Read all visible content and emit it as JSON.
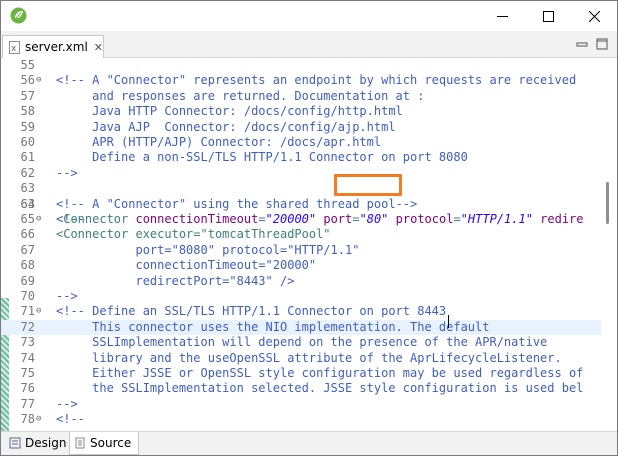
{
  "window": {
    "app_icon": "spring-leaf-icon",
    "controls": [
      "minimize-icon",
      "maximize-icon",
      "close-icon"
    ]
  },
  "tab": {
    "label": "server.xml",
    "close": "✕",
    "icon": "xml-file-icon"
  },
  "view_controls": [
    "minimize-view-icon",
    "maximize-view-icon"
  ],
  "editor": {
    "lines": [
      {
        "n": "55",
        "fold": "",
        "code": ""
      },
      {
        "n": "56",
        "fold": "⊖",
        "code": "<!-- A \"Connector\" represents an endpoint by which requests are received"
      },
      {
        "n": "57",
        "fold": "",
        "code": "     and responses are returned. Documentation at :"
      },
      {
        "n": "58",
        "fold": "",
        "code": "     Java HTTP Connector: /docs/config/http.html"
      },
      {
        "n": "59",
        "fold": "",
        "code": "     Java AJP  Connector: /docs/config/ajp.html"
      },
      {
        "n": "60",
        "fold": "",
        "code": "     APR (HTTP/AJP) Connector: /docs/apr.html"
      },
      {
        "n": "61",
        "fold": "",
        "code": "     Define a non-SSL/TLS HTTP/1.1 Connector on port 8080"
      },
      {
        "n": "62",
        "fold": "",
        "code": "-->"
      },
      {
        "n": "63",
        "fold": "",
        "code": ""
      },
      {
        "n": "64",
        "fold": "",
        "code": "<!-- A \"Connector\" using the shared thread pool-->"
      },
      {
        "n": "65",
        "fold": "⊖",
        "code": "<!--"
      },
      {
        "n": "66",
        "fold": "",
        "code": "<Connector executor=\"tomcatThreadPool\""
      },
      {
        "n": "67",
        "fold": "",
        "code": "           port=\"8080\" protocol=\"HTTP/1.1\""
      },
      {
        "n": "68",
        "fold": "",
        "code": "           connectionTimeout=\"20000\""
      },
      {
        "n": "69",
        "fold": "",
        "code": "           redirectPort=\"8443\" />"
      },
      {
        "n": "70",
        "fold": "",
        "code": "-->"
      },
      {
        "n": "71",
        "fold": "⊖",
        "code": "<!-- Define an SSL/TLS HTTP/1.1 Connector on port 8443"
      },
      {
        "n": "72",
        "fold": "",
        "code": "     This connector uses the NIO implementation. The default"
      },
      {
        "n": "73",
        "fold": "",
        "code": "     SSLImplementation will depend on the presence of the APR/native"
      },
      {
        "n": "74",
        "fold": "",
        "code": "     library and the useOpenSSL attribute of the AprLifecycleListener."
      },
      {
        "n": "75",
        "fold": "",
        "code": "     Either JSSE or OpenSSL style configuration may be used regardless of"
      },
      {
        "n": "76",
        "fold": "",
        "code": "     the SSLImplementation selected. JSSE style configuration is used bel"
      },
      {
        "n": "77",
        "fold": "",
        "code": "-->"
      },
      {
        "n": "78",
        "fold": "⊖",
        "code": "<!--"
      }
    ],
    "line63": {
      "open": "<Connector ",
      "attr1": "connectionTimeout",
      "eq1": "=",
      "val1": "\"20000\"",
      "attr2": "port",
      "eq2": "=",
      "val2": "\"80\"",
      "attr3": "protocol",
      "eq3": "=",
      "val3": "\"HTTP/1.1\"",
      "tail": " redire"
    },
    "highlighted_line": "72"
  },
  "bottom_tabs": [
    {
      "label": "Design",
      "icon": "design-icon"
    },
    {
      "label": "Source",
      "icon": "source-icon"
    }
  ],
  "colors": {
    "highlight_box": "#f07d1f",
    "comment": "#3f5fbf",
    "tag": "#3f7f7f",
    "attr": "#7f007f",
    "value": "#2a00ff"
  }
}
